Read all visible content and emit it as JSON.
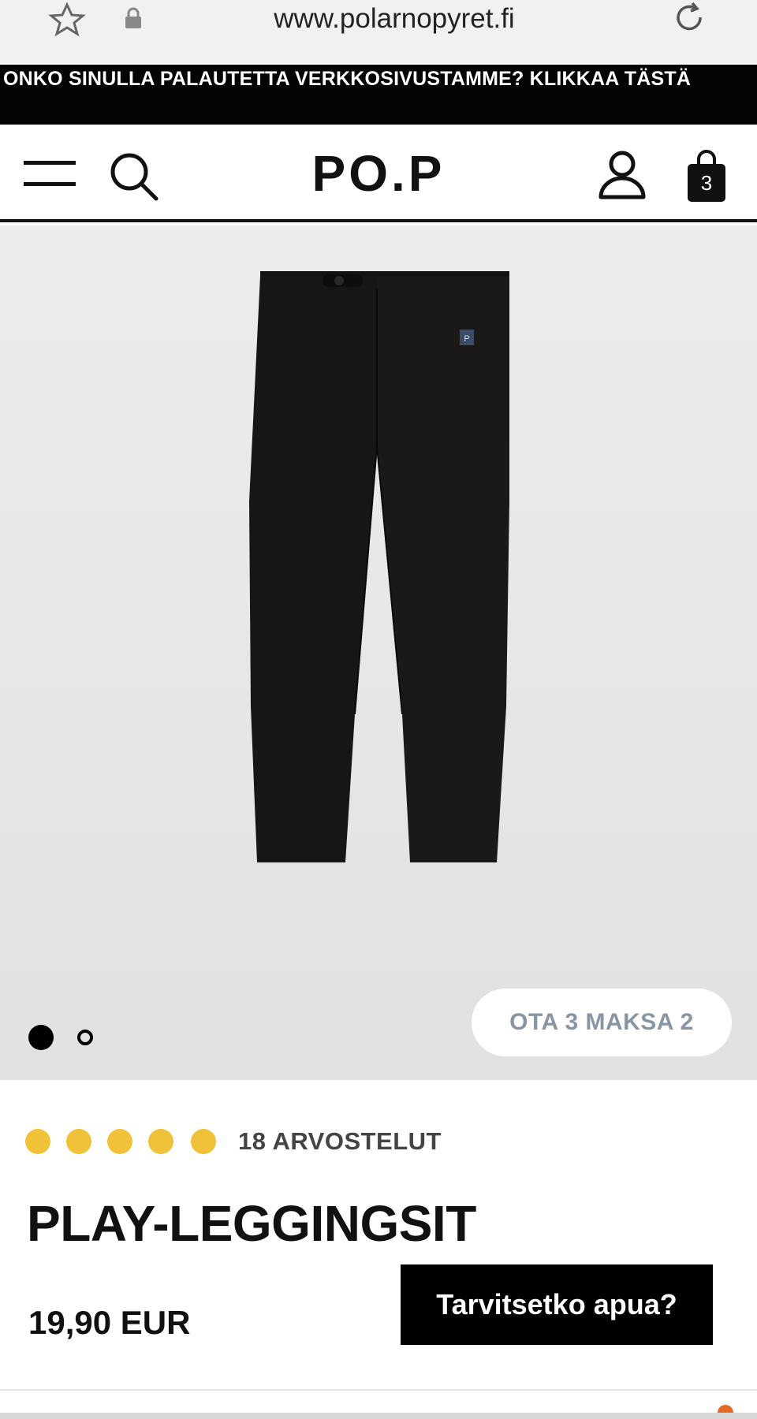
{
  "browser": {
    "url": "www.polarnopyret.fi",
    "icons": [
      "star-icon",
      "lock-icon",
      "reload-icon"
    ]
  },
  "banner": {
    "text": "ONKO SINULLA PALAUTETTA VERKKOSIVUSTAMME? KLIKKAA TÄSTÄ"
  },
  "header": {
    "logo": "PO.P",
    "bag_count": "3",
    "icons": [
      "menu-icon",
      "search-icon",
      "account-icon",
      "shopping-bag-icon"
    ]
  },
  "gallery": {
    "image": "black leggings",
    "slides_total": 2,
    "active_slide": 1,
    "promo": "OTA 3 MAKSA 2"
  },
  "product": {
    "rating_dots": 5,
    "rating_color": "#f0c23a",
    "reviews_label": "18 ARVOSTELUT",
    "title": "PLAY-LEGGINGSIT",
    "price": "19,90 EUR"
  },
  "chat": {
    "label": "Tarvitsetko apua?"
  }
}
